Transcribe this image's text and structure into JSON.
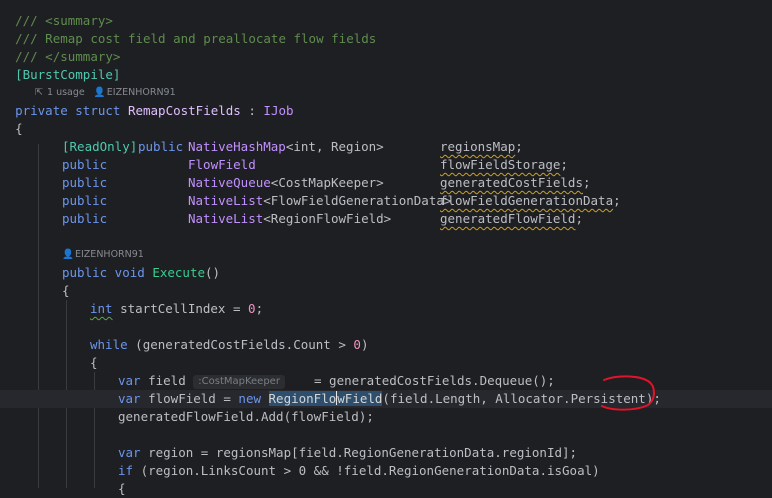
{
  "code": {
    "summary_open": "/// <summary>",
    "summary_text": "/// Remap cost field and preallocate flow fields",
    "summary_close": "/// </summary>",
    "attribute": "[BurstCompile]",
    "usage_meta": "1 usage",
    "author_meta": "EIZENHORN91",
    "struct_kw": "private struct",
    "struct_name": "RemapCostFields",
    "struct_colon": " : ",
    "struct_iface": "IJob",
    "open_brace": "{",
    "field_rows": [
      {
        "attr": "[ReadOnly]",
        "mod": "public",
        "type": "NativeHashMap",
        "generic": "<int, Region>",
        "name": "regionsMap",
        "semi": ";"
      },
      {
        "attr": "",
        "mod": "public",
        "type": "FlowField",
        "generic": "",
        "name": "flowFieldStorage",
        "semi": ";"
      },
      {
        "attr": "",
        "mod": "public",
        "type": "NativeQueue",
        "generic": "<CostMapKeeper>",
        "name": "generatedCostFields",
        "semi": ";"
      },
      {
        "attr": "",
        "mod": "public",
        "type": "NativeList",
        "generic": "<FlowFieldGenerationData>",
        "name": "flowFieldGenerationData",
        "semi": ";"
      },
      {
        "attr": "",
        "mod": "public",
        "type": "NativeList",
        "generic": "<RegionFlowField>",
        "name": "generatedFlowField",
        "semi": ";"
      }
    ],
    "method_author": "EIZENHORN91",
    "method_mod": "public void",
    "method_name": "Execute",
    "method_parens": "()",
    "l_int": "int",
    "l_int_rest": " startCellIndex = ",
    "l_int_num": "0",
    "l_int_semi": ";",
    "l_while_kw": "while",
    "l_while_a": " (generatedCostFields.Count > ",
    "l_while_num": "0",
    "l_while_b": ")",
    "l_var1_kw": "var",
    "l_var1_name": " field ",
    "l_var1_hint": ":CostMapKeeper",
    "l_var1_rest": "= generatedCostFields.Dequeue();",
    "l_var2_kw": "var",
    "l_var2_name": " flowField = ",
    "l_var2_new": "new",
    "l_var2_type_a": "RegionFlo",
    "l_var2_type_b": "wField",
    "l_var2_args": "(field.Length, Allocator.Persistent);",
    "l_add": "generatedFlowField.Add(flowField);",
    "l_var3_kw": "var",
    "l_var3_rest": " region = regionsMap[field.RegionGenerationData.regionId];",
    "l_if_kw": "if",
    "l_if_rest": " (region.LinksCount > 0 && !field.RegionGenerationData.isGoal)",
    "l_last": "{"
  },
  "icons": {
    "usage": "usage-arrow-icon",
    "author": "person-icon"
  },
  "colors": {
    "background": "#1e1f22",
    "annotation": "#e0142a"
  }
}
